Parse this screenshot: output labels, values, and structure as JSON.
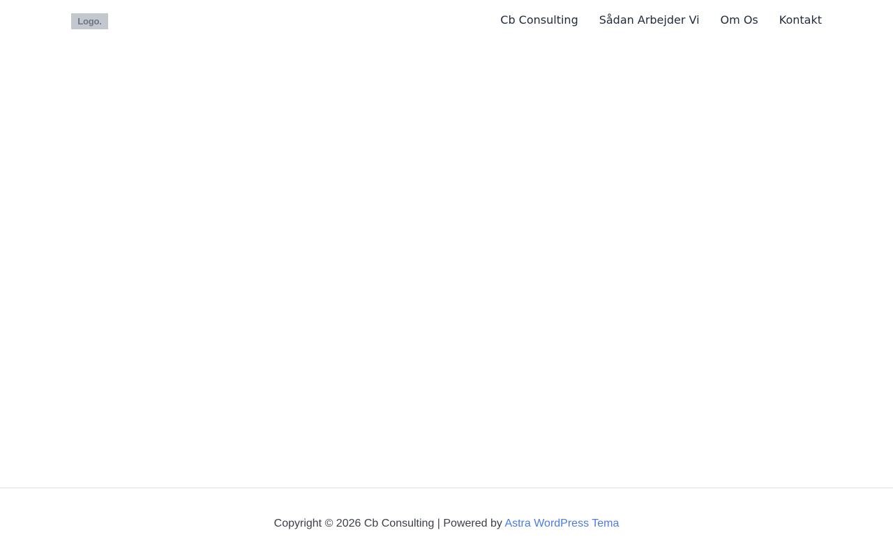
{
  "header": {
    "logo_text": "Logo.",
    "nav": [
      {
        "label": "Cb Consulting"
      },
      {
        "label": "Sådan Arbejder Vi"
      },
      {
        "label": "Om Os"
      },
      {
        "label": "Kontakt"
      }
    ]
  },
  "footer": {
    "copyright_prefix": "Copyright © 2026 Cb Consulting | Powered by",
    "link_label": "Astra WordPress Tema"
  },
  "colors": {
    "nav_text": "#1e2a3b",
    "link": "#4a7be8",
    "logo_bg": "#c3c8ce"
  }
}
